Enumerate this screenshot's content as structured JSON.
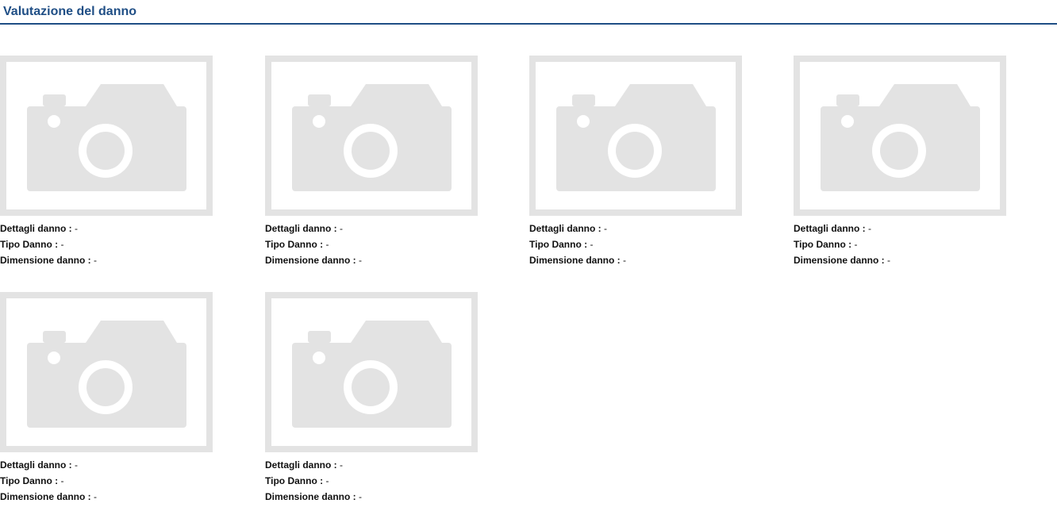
{
  "section": {
    "title": "Valutazione del danno"
  },
  "labels": {
    "details": "Dettagli danno :",
    "type": "Tipo Danno :",
    "size": "Dimensione danno :"
  },
  "photos": [
    {
      "icon": "camera-placeholder-icon",
      "details": "-",
      "type": "-",
      "size": "-"
    },
    {
      "icon": "camera-placeholder-icon",
      "details": "-",
      "type": "-",
      "size": "-"
    },
    {
      "icon": "camera-placeholder-icon",
      "details": "-",
      "type": "-",
      "size": "-"
    },
    {
      "icon": "camera-placeholder-icon",
      "details": "-",
      "type": "-",
      "size": "-"
    },
    {
      "icon": "camera-placeholder-icon",
      "details": "-",
      "type": "-",
      "size": "-"
    },
    {
      "icon": "camera-placeholder-icon",
      "details": "-",
      "type": "-",
      "size": "-"
    }
  ],
  "colors": {
    "accent": "#1f4e85",
    "placeholder_frame": "#e3e3e3"
  }
}
